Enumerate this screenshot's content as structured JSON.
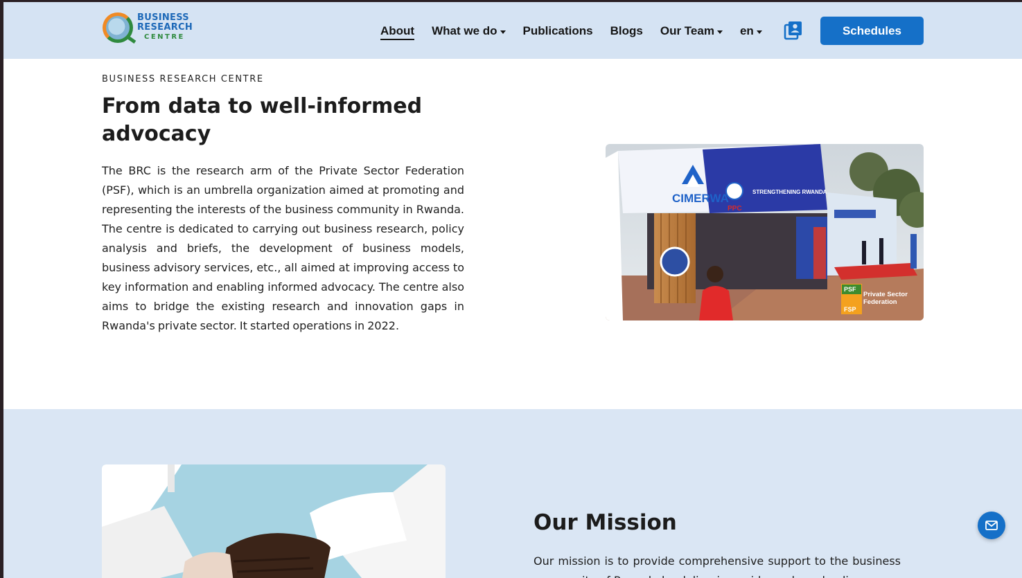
{
  "header": {
    "logo": {
      "line1": "BUSINESS",
      "line2": "RESEARCH",
      "line3": "CENTRE"
    },
    "nav": [
      {
        "label": "About",
        "active": true,
        "dropdown": false
      },
      {
        "label": "What we do",
        "active": false,
        "dropdown": true
      },
      {
        "label": "Publications",
        "active": false,
        "dropdown": false
      },
      {
        "label": "Blogs",
        "active": false,
        "dropdown": false
      },
      {
        "label": "Our Team",
        "active": false,
        "dropdown": true
      },
      {
        "label": "en",
        "active": false,
        "dropdown": true
      }
    ],
    "contacts_icon": "contact-book-icon",
    "schedules_label": "Schedules"
  },
  "about": {
    "eyebrow": "BUSINESS RESEARCH CENTRE",
    "title": "From data to well-informed advocacy",
    "body": "The BRC is the research arm of the Private Sector Federation (PSF), which is an umbrella organization aimed at promoting and representing the interests of the business community in Rwanda. The centre is dedicated to carrying out business research, policy analysis and briefs, the development of business models, business advisory services, etc., all aimed at improving access to key information and enabling informed advocacy. The centre also aims to bridge the existing research and innovation gaps in Rwanda's private sector. It started operations in 2022.",
    "photo": {
      "booth_brand": "CIMERWA",
      "booth_slogan": "STRENGTHENING RWANDA",
      "booth_ppc": "PPC",
      "badge_top": "PSF",
      "badge_bottom": "FSP",
      "badge_text": "Private Sector Federation"
    }
  },
  "mission": {
    "title": "Our Mission",
    "body": "Our mission is to provide comprehensive support to the business community of Rwanda by delivering evidence-based policy"
  },
  "fab_icon": "mail-icon",
  "colors": {
    "header_bg": "#d5e3f3",
    "accent": "#1570c8",
    "mission_bg": "#dae6f4"
  }
}
